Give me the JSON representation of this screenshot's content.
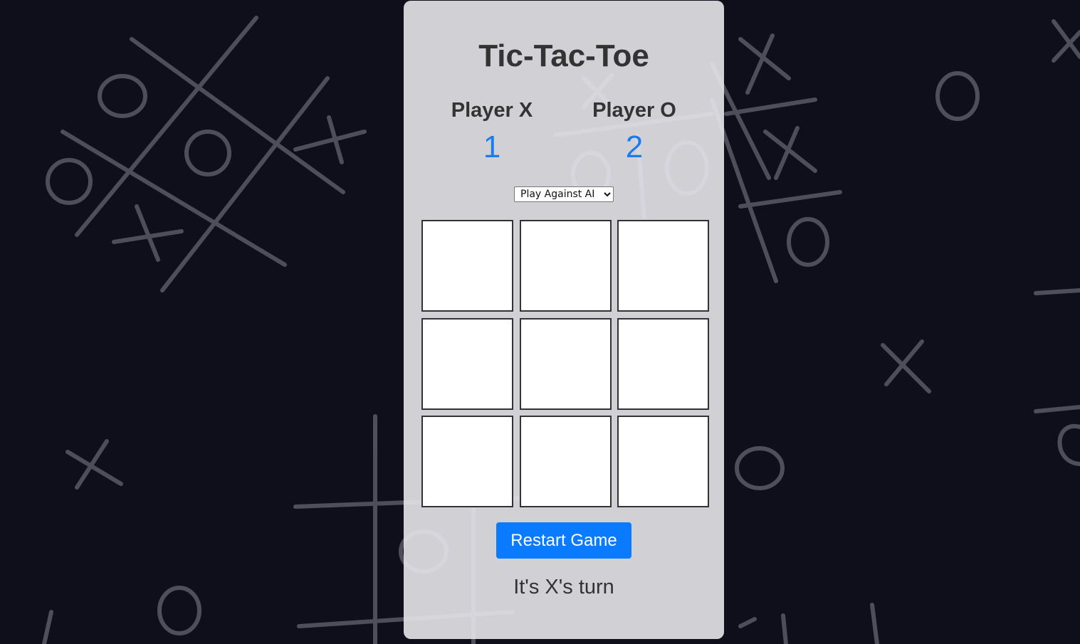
{
  "game": {
    "title": "Tic-Tac-Toe",
    "players": [
      {
        "label": "Player X",
        "score": "1"
      },
      {
        "label": "Player O",
        "score": "2"
      }
    ],
    "mode": {
      "selected": "Play Against AI",
      "options": [
        "Play Against AI"
      ]
    },
    "board": [
      "",
      "",
      "",
      "",
      "",
      "",
      "",
      "",
      ""
    ],
    "restart_label": "Restart Game",
    "status": "It's X's turn"
  },
  "colors": {
    "background": "#0f0f1c",
    "panel": "#e6e6ea",
    "accent": "#0a7bff",
    "score": "#1a7cf0",
    "text": "#333333"
  }
}
